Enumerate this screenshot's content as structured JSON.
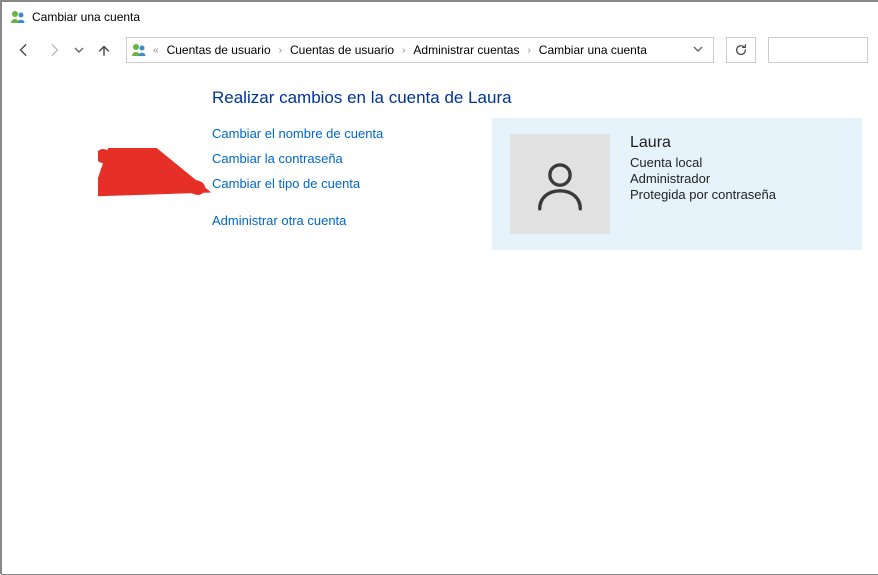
{
  "window": {
    "title": "Cambiar una cuenta"
  },
  "breadcrumbs": {
    "prefix": "«",
    "items": [
      "Cuentas de usuario",
      "Cuentas de usuario",
      "Administrar cuentas",
      "Cambiar una cuenta"
    ]
  },
  "page": {
    "heading": "Realizar cambios en la cuenta de Laura",
    "links": {
      "rename": "Cambiar el nombre de cuenta",
      "password": "Cambiar la contraseña",
      "type": "Cambiar el tipo de cuenta",
      "other": "Administrar otra cuenta"
    }
  },
  "account": {
    "name": "Laura",
    "kind": "Cuenta local",
    "role": "Administrador",
    "protection": "Protegida por contraseña"
  }
}
